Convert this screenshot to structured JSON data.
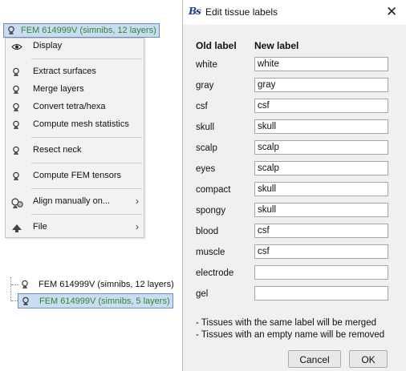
{
  "tree_top": {
    "selected_node_label": "FEM 614999V (simnibs, 12 layers)"
  },
  "context_menu": {
    "items": [
      {
        "label": "Display",
        "icon": "eye-icon"
      },
      {
        "label": "Extract surfaces",
        "icon": "fem-mesh-icon"
      },
      {
        "label": "Merge layers",
        "icon": "fem-mesh-icon"
      },
      {
        "label": "Convert tetra/hexa",
        "icon": "fem-mesh-icon"
      },
      {
        "label": "Compute mesh statistics",
        "icon": "fem-mesh-icon"
      },
      {
        "label": "Resect neck",
        "icon": "fem-mesh-icon"
      },
      {
        "label": "Compute FEM tensors",
        "icon": "fem-mesh-icon"
      },
      {
        "label": "Align manually on...",
        "icon": "align-icon",
        "submenu": true
      },
      {
        "label": "File",
        "icon": "file-icon",
        "submenu": true
      }
    ]
  },
  "tree_bottom": {
    "nodes": [
      {
        "label": "FEM 614999V (simnibs, 12 layers)",
        "selected": false
      },
      {
        "label": "FEM 614999V (simnibs, 5 layers)",
        "selected": true
      }
    ]
  },
  "dialog": {
    "title": "Edit tissue labels",
    "logo_text": "Bs",
    "header_old": "Old label",
    "header_new": "New label",
    "rows": [
      {
        "old": "white",
        "new": "white"
      },
      {
        "old": "gray",
        "new": "gray"
      },
      {
        "old": "csf",
        "new": "csf"
      },
      {
        "old": "skull",
        "new": "skull"
      },
      {
        "old": "scalp",
        "new": "scalp"
      },
      {
        "old": "eyes",
        "new": "scalp"
      },
      {
        "old": "compact",
        "new": "skull"
      },
      {
        "old": "spongy",
        "new": "skull"
      },
      {
        "old": "blood",
        "new": "csf"
      },
      {
        "old": "muscle",
        "new": "csf"
      },
      {
        "old": "electrode",
        "new": ""
      },
      {
        "old": "gel",
        "new": ""
      }
    ],
    "note1": "- Tissues with the same label will be merged",
    "note2": "- Tissues with an empty name will be removed",
    "cancel_label": "Cancel",
    "ok_label": "OK"
  },
  "colors": {
    "selection_bg": "#c9dcf2",
    "selection_text": "#2e8a2e",
    "logo": "#1b3e8a"
  }
}
